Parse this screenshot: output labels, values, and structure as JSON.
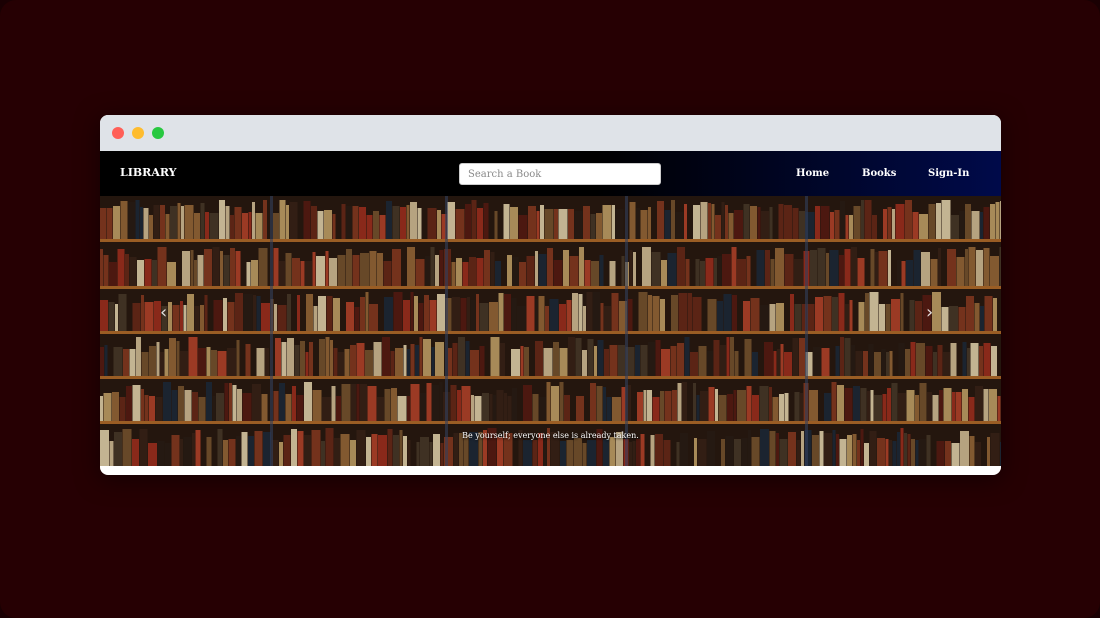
{
  "navbar": {
    "brand": "LIBRARY",
    "search_placeholder": "Search a Book",
    "links": [
      {
        "label": "Home"
      },
      {
        "label": "Books"
      },
      {
        "label": "Sign-In"
      }
    ]
  },
  "carousel": {
    "caption": "Be yourself; everyone else is already taken.",
    "prev_icon": "chevron-left-icon",
    "next_icon": "chevron-right-icon",
    "image": "bookshelf-photo"
  },
  "colors": {
    "page_background": "#260003",
    "navbar_start": "#000000",
    "navbar_end": "#000a4a",
    "shelf_wood": "#b06a2a"
  }
}
